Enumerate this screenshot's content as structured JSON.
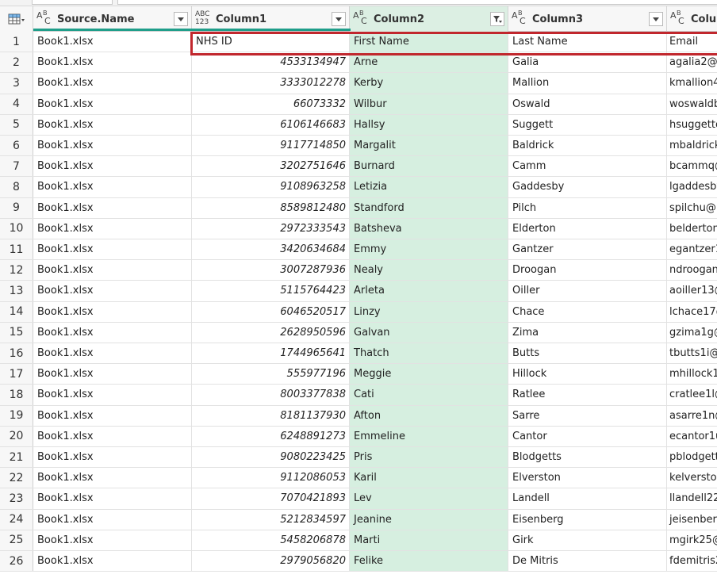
{
  "header": {
    "columns": [
      {
        "type_top": "A",
        "type_sub": "B",
        "type_bot": "C",
        "name": "Source.Name"
      },
      {
        "type_top": "ABC",
        "type_bot": "123",
        "name": "Column1"
      },
      {
        "type_top": "A",
        "type_sub": "B",
        "type_bot": "C",
        "name": "Column2"
      },
      {
        "type_top": "A",
        "type_sub": "B",
        "type_bot": "C",
        "name": "Column3"
      },
      {
        "type_top": "A",
        "type_sub": "B",
        "type_bot": "C",
        "name": "Colu"
      }
    ]
  },
  "rows": [
    [
      "1",
      "Book1.xlsx",
      "NHS ID",
      "First Name",
      "Last Name",
      "Email"
    ],
    [
      "2",
      "Book1.xlsx",
      "4533134947",
      "Arne",
      "Galia",
      "agalia2@"
    ],
    [
      "3",
      "Book1.xlsx",
      "3333012278",
      "Kerby",
      "Mallion",
      "kmallion4"
    ],
    [
      "4",
      "Book1.xlsx",
      "66073332",
      "Wilbur",
      "Oswald",
      "woswaldb"
    ],
    [
      "5",
      "Book1.xlsx",
      "6106146683",
      "Hallsy",
      "Suggett",
      "hsuggetto"
    ],
    [
      "6",
      "Book1.xlsx",
      "9117714850",
      "Margalit",
      "Baldrick",
      "mbaldrick"
    ],
    [
      "7",
      "Book1.xlsx",
      "3202751646",
      "Burnard",
      "Camm",
      "bcammq@"
    ],
    [
      "8",
      "Book1.xlsx",
      "9108963258",
      "Letizia",
      "Gaddesby",
      "lgaddesby"
    ],
    [
      "9",
      "Book1.xlsx",
      "8589812480",
      "Standford",
      "Pilch",
      "spilchu@"
    ],
    [
      "10",
      "Book1.xlsx",
      "2972333543",
      "Batsheva",
      "Elderton",
      "belderton"
    ],
    [
      "11",
      "Book1.xlsx",
      "3420634684",
      "Emmy",
      "Gantzer",
      "egantzer1"
    ],
    [
      "12",
      "Book1.xlsx",
      "3007287936",
      "Nealy",
      "Droogan",
      "ndroogan"
    ],
    [
      "13",
      "Book1.xlsx",
      "5115764423",
      "Arleta",
      "Oiller",
      "aoiller13@"
    ],
    [
      "14",
      "Book1.xlsx",
      "6046520517",
      "Linzy",
      "Chace",
      "lchace17@"
    ],
    [
      "15",
      "Book1.xlsx",
      "2628950596",
      "Galvan",
      "Zima",
      "gzima1g@"
    ],
    [
      "16",
      "Book1.xlsx",
      "1744965641",
      "Thatch",
      "Butts",
      "tbutts1i@"
    ],
    [
      "17",
      "Book1.xlsx",
      "555977196",
      "Meggie",
      "Hillock",
      "mhillock1"
    ],
    [
      "18",
      "Book1.xlsx",
      "8003377838",
      "Cati",
      "Ratlee",
      "cratlee1l@"
    ],
    [
      "19",
      "Book1.xlsx",
      "8181137930",
      "Afton",
      "Sarre",
      "asarre1n@"
    ],
    [
      "20",
      "Book1.xlsx",
      "6248891273",
      "Emmeline",
      "Cantor",
      "ecantor1u"
    ],
    [
      "21",
      "Book1.xlsx",
      "9080223425",
      "Pris",
      "Blodgetts",
      "pblodgett"
    ],
    [
      "22",
      "Book1.xlsx",
      "9112086053",
      "Karil",
      "Elverston",
      "kelverstor"
    ],
    [
      "23",
      "Book1.xlsx",
      "7070421893",
      "Lev",
      "Landell",
      "llandell22"
    ],
    [
      "24",
      "Book1.xlsx",
      "5212834597",
      "Jeanine",
      "Eisenberg",
      "jeisenberg"
    ],
    [
      "25",
      "Book1.xlsx",
      "5458206878",
      "Marti",
      "Girk",
      "mgirk25@"
    ],
    [
      "26",
      "Book1.xlsx",
      "2979056820",
      "Felike",
      "De Mitris",
      "fdemitris2"
    ]
  ]
}
